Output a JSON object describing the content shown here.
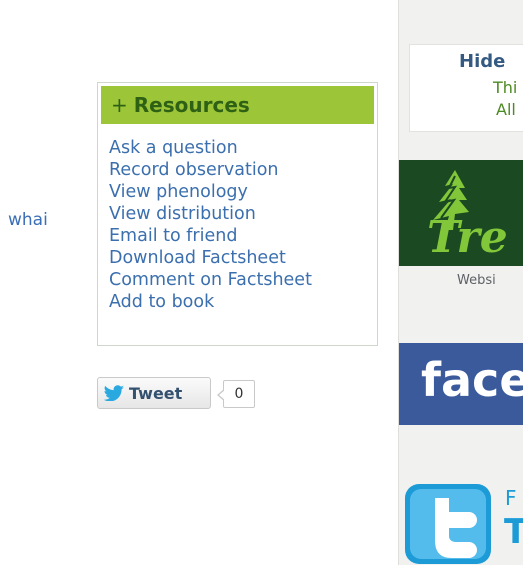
{
  "left_fragment": "whai",
  "resources": {
    "title": "Resources",
    "plus": "+",
    "links": [
      "Ask a question",
      "Record observation",
      "View phenology",
      "View distribution",
      "Email to friend",
      "Download Factsheet",
      "Comment on Factsheet",
      "Add to book"
    ]
  },
  "tweet": {
    "label": "Tweet",
    "count": "0"
  },
  "sidebar": {
    "hide_box": {
      "title": "Hide",
      "line2": "Thi",
      "line3": "All"
    },
    "trees_logo_text": "Tre",
    "website_caption": "Websi",
    "facebook_logo_text": "face",
    "twitter": {
      "follow_text": "F",
      "big_text": "T"
    }
  },
  "colors": {
    "resources_header": "#9cc638",
    "resources_title_text": "#2f6115",
    "link": "#3b6fae",
    "sidebar_bg": "#f1f2ef",
    "trees_bg": "#1b4a22",
    "trees_text": "#82c73a",
    "facebook_blue": "#3b5a9c",
    "twitter_blue": "#1c9bd7"
  },
  "icons": {
    "tweet": "twitter-bird-icon",
    "trees": "tree-icon",
    "twitter": "twitter-t-icon"
  }
}
